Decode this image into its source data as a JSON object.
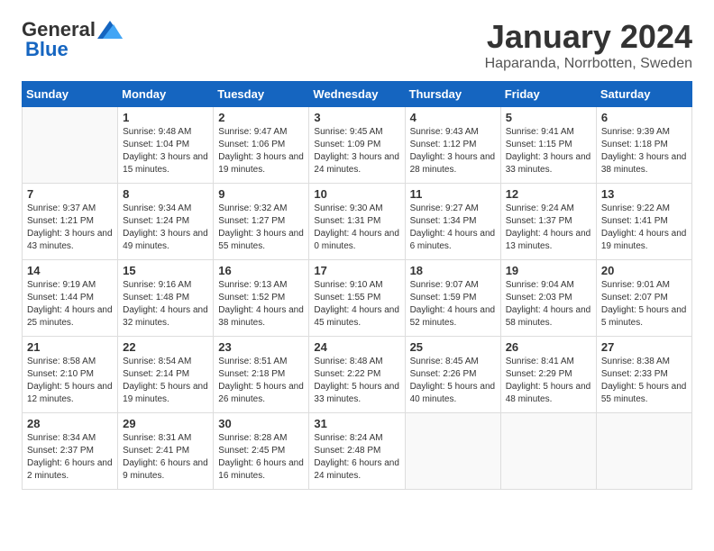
{
  "header": {
    "logo_general": "General",
    "logo_blue": "Blue",
    "month_title": "January 2024",
    "location": "Haparanda, Norrbotten, Sweden"
  },
  "weekdays": [
    "Sunday",
    "Monday",
    "Tuesday",
    "Wednesday",
    "Thursday",
    "Friday",
    "Saturday"
  ],
  "weeks": [
    [
      {
        "day": "",
        "sunrise": "",
        "sunset": "",
        "daylight": ""
      },
      {
        "day": "1",
        "sunrise": "Sunrise: 9:48 AM",
        "sunset": "Sunset: 1:04 PM",
        "daylight": "Daylight: 3 hours and 15 minutes."
      },
      {
        "day": "2",
        "sunrise": "Sunrise: 9:47 AM",
        "sunset": "Sunset: 1:06 PM",
        "daylight": "Daylight: 3 hours and 19 minutes."
      },
      {
        "day": "3",
        "sunrise": "Sunrise: 9:45 AM",
        "sunset": "Sunset: 1:09 PM",
        "daylight": "Daylight: 3 hours and 24 minutes."
      },
      {
        "day": "4",
        "sunrise": "Sunrise: 9:43 AM",
        "sunset": "Sunset: 1:12 PM",
        "daylight": "Daylight: 3 hours and 28 minutes."
      },
      {
        "day": "5",
        "sunrise": "Sunrise: 9:41 AM",
        "sunset": "Sunset: 1:15 PM",
        "daylight": "Daylight: 3 hours and 33 minutes."
      },
      {
        "day": "6",
        "sunrise": "Sunrise: 9:39 AM",
        "sunset": "Sunset: 1:18 PM",
        "daylight": "Daylight: 3 hours and 38 minutes."
      }
    ],
    [
      {
        "day": "7",
        "sunrise": "Sunrise: 9:37 AM",
        "sunset": "Sunset: 1:21 PM",
        "daylight": "Daylight: 3 hours and 43 minutes."
      },
      {
        "day": "8",
        "sunrise": "Sunrise: 9:34 AM",
        "sunset": "Sunset: 1:24 PM",
        "daylight": "Daylight: 3 hours and 49 minutes."
      },
      {
        "day": "9",
        "sunrise": "Sunrise: 9:32 AM",
        "sunset": "Sunset: 1:27 PM",
        "daylight": "Daylight: 3 hours and 55 minutes."
      },
      {
        "day": "10",
        "sunrise": "Sunrise: 9:30 AM",
        "sunset": "Sunset: 1:31 PM",
        "daylight": "Daylight: 4 hours and 0 minutes."
      },
      {
        "day": "11",
        "sunrise": "Sunrise: 9:27 AM",
        "sunset": "Sunset: 1:34 PM",
        "daylight": "Daylight: 4 hours and 6 minutes."
      },
      {
        "day": "12",
        "sunrise": "Sunrise: 9:24 AM",
        "sunset": "Sunset: 1:37 PM",
        "daylight": "Daylight: 4 hours and 13 minutes."
      },
      {
        "day": "13",
        "sunrise": "Sunrise: 9:22 AM",
        "sunset": "Sunset: 1:41 PM",
        "daylight": "Daylight: 4 hours and 19 minutes."
      }
    ],
    [
      {
        "day": "14",
        "sunrise": "Sunrise: 9:19 AM",
        "sunset": "Sunset: 1:44 PM",
        "daylight": "Daylight: 4 hours and 25 minutes."
      },
      {
        "day": "15",
        "sunrise": "Sunrise: 9:16 AM",
        "sunset": "Sunset: 1:48 PM",
        "daylight": "Daylight: 4 hours and 32 minutes."
      },
      {
        "day": "16",
        "sunrise": "Sunrise: 9:13 AM",
        "sunset": "Sunset: 1:52 PM",
        "daylight": "Daylight: 4 hours and 38 minutes."
      },
      {
        "day": "17",
        "sunrise": "Sunrise: 9:10 AM",
        "sunset": "Sunset: 1:55 PM",
        "daylight": "Daylight: 4 hours and 45 minutes."
      },
      {
        "day": "18",
        "sunrise": "Sunrise: 9:07 AM",
        "sunset": "Sunset: 1:59 PM",
        "daylight": "Daylight: 4 hours and 52 minutes."
      },
      {
        "day": "19",
        "sunrise": "Sunrise: 9:04 AM",
        "sunset": "Sunset: 2:03 PM",
        "daylight": "Daylight: 4 hours and 58 minutes."
      },
      {
        "day": "20",
        "sunrise": "Sunrise: 9:01 AM",
        "sunset": "Sunset: 2:07 PM",
        "daylight": "Daylight: 5 hours and 5 minutes."
      }
    ],
    [
      {
        "day": "21",
        "sunrise": "Sunrise: 8:58 AM",
        "sunset": "Sunset: 2:10 PM",
        "daylight": "Daylight: 5 hours and 12 minutes."
      },
      {
        "day": "22",
        "sunrise": "Sunrise: 8:54 AM",
        "sunset": "Sunset: 2:14 PM",
        "daylight": "Daylight: 5 hours and 19 minutes."
      },
      {
        "day": "23",
        "sunrise": "Sunrise: 8:51 AM",
        "sunset": "Sunset: 2:18 PM",
        "daylight": "Daylight: 5 hours and 26 minutes."
      },
      {
        "day": "24",
        "sunrise": "Sunrise: 8:48 AM",
        "sunset": "Sunset: 2:22 PM",
        "daylight": "Daylight: 5 hours and 33 minutes."
      },
      {
        "day": "25",
        "sunrise": "Sunrise: 8:45 AM",
        "sunset": "Sunset: 2:26 PM",
        "daylight": "Daylight: 5 hours and 40 minutes."
      },
      {
        "day": "26",
        "sunrise": "Sunrise: 8:41 AM",
        "sunset": "Sunset: 2:29 PM",
        "daylight": "Daylight: 5 hours and 48 minutes."
      },
      {
        "day": "27",
        "sunrise": "Sunrise: 8:38 AM",
        "sunset": "Sunset: 2:33 PM",
        "daylight": "Daylight: 5 hours and 55 minutes."
      }
    ],
    [
      {
        "day": "28",
        "sunrise": "Sunrise: 8:34 AM",
        "sunset": "Sunset: 2:37 PM",
        "daylight": "Daylight: 6 hours and 2 minutes."
      },
      {
        "day": "29",
        "sunrise": "Sunrise: 8:31 AM",
        "sunset": "Sunset: 2:41 PM",
        "daylight": "Daylight: 6 hours and 9 minutes."
      },
      {
        "day": "30",
        "sunrise": "Sunrise: 8:28 AM",
        "sunset": "Sunset: 2:45 PM",
        "daylight": "Daylight: 6 hours and 16 minutes."
      },
      {
        "day": "31",
        "sunrise": "Sunrise: 8:24 AM",
        "sunset": "Sunset: 2:48 PM",
        "daylight": "Daylight: 6 hours and 24 minutes."
      },
      {
        "day": "",
        "sunrise": "",
        "sunset": "",
        "daylight": ""
      },
      {
        "day": "",
        "sunrise": "",
        "sunset": "",
        "daylight": ""
      },
      {
        "day": "",
        "sunrise": "",
        "sunset": "",
        "daylight": ""
      }
    ]
  ]
}
